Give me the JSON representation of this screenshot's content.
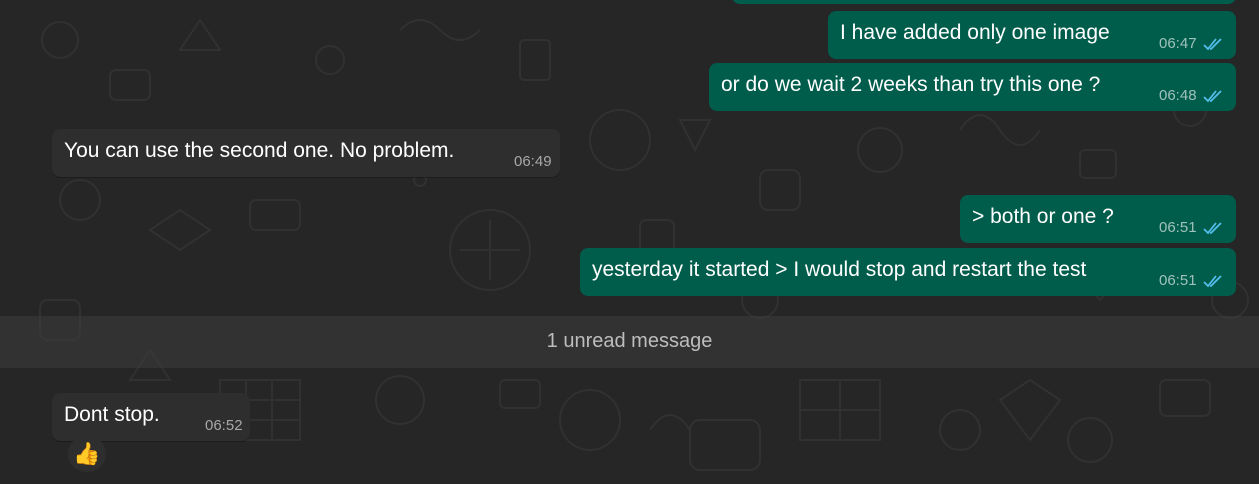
{
  "conversation": {
    "messages": [
      {
        "direction": "out",
        "text": "I have added only one image",
        "time": "06:47",
        "status": "read"
      },
      {
        "direction": "out",
        "text": "or do we wait 2 weeks than try this one ?",
        "time": "06:48",
        "status": "read"
      },
      {
        "direction": "in",
        "text": "You can use the second one. No problem.",
        "time": "06:49"
      },
      {
        "direction": "out",
        "text": "> both or one ?",
        "time": "06:51",
        "status": "read"
      },
      {
        "direction": "out",
        "text": "yesterday it started > I would stop and restart the test",
        "time": "06:51",
        "status": "read"
      },
      {
        "direction": "in",
        "text": "Dont stop.",
        "time": "06:52",
        "reaction": "👍"
      }
    ],
    "unread_divider": "1 unread message"
  },
  "colors": {
    "background": "#262626",
    "outgoing_bubble": "#005c4b",
    "incoming_bubble": "#2e2e2e",
    "read_ticks": "#53bdeb",
    "text": "#ffffff"
  },
  "icons": {
    "read_receipt": "double-check-icon",
    "reaction": "thumbs-up-emoji"
  }
}
